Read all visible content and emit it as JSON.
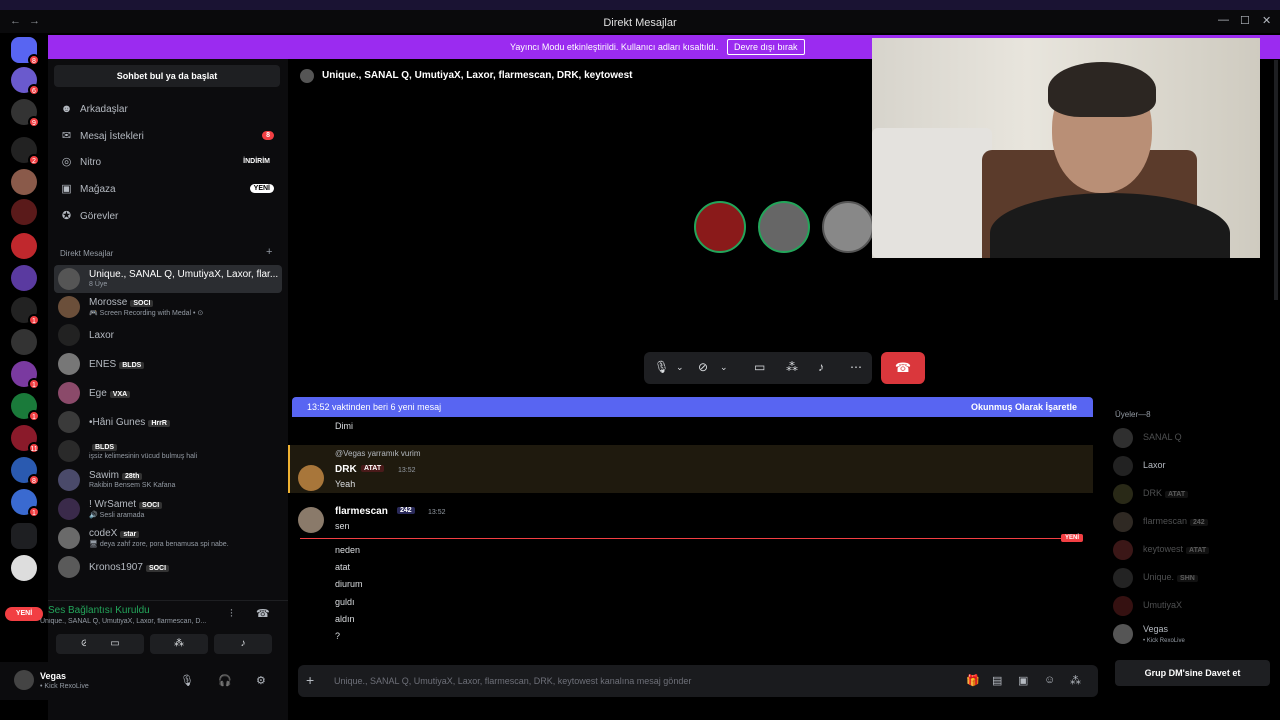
{
  "window": {
    "title": "Direkt Mesajlar",
    "back": "←",
    "forward": "→",
    "minimize": "—",
    "maximize": "☐",
    "close": "✕"
  },
  "banner": {
    "text": "Yayıncı Modu etkinleştirildi. Kullanıcı adları kısaltıldı.",
    "button": "Devre dışı bırak"
  },
  "servers": {
    "badges": [
      "8",
      "6",
      "9",
      "2",
      "1",
      "1",
      "1",
      "11",
      "8",
      "1"
    ],
    "new_pill": "YENİ"
  },
  "sidebar": {
    "search": "Sohbet bul ya da başlat",
    "nav": [
      {
        "label": "Arkadaşlar",
        "icon": "friends-icon",
        "glyph": "☻"
      },
      {
        "label": "Mesaj İstekleri",
        "icon": "mail-icon",
        "glyph": "✉",
        "badge": "8"
      },
      {
        "label": "Nitro",
        "icon": "nitro-icon",
        "glyph": "◎",
        "badge": "İNDİRİM"
      },
      {
        "label": "Mağaza",
        "icon": "shop-icon",
        "glyph": "▣",
        "badge": "YENİ"
      },
      {
        "label": "Görevler",
        "icon": "quests-icon",
        "glyph": "✪"
      }
    ],
    "dm_header": "Direkt Mesajlar",
    "dm_add": "+",
    "dms": [
      {
        "name": "Unique., SANAL Q, UmutiyaX, Laxor, flar...",
        "sub": "8 Üye",
        "color": "#555"
      },
      {
        "name": "Morosse",
        "tag": "SOCI",
        "sub": "🎮 Screen Recording with Medal • ⊙",
        "color": "#6b4f3a"
      },
      {
        "name": "Laxor",
        "color": "#222"
      },
      {
        "name": "ENES",
        "tag": "BLDS",
        "color": "#777"
      },
      {
        "name": "Ege",
        "tag": "VXA",
        "color": "#8b4a6a"
      },
      {
        "name": "•Hâni Gunes",
        "tag": "HrrR",
        "color": "#3a3a3a"
      },
      {
        "name": "",
        "tag": "BLDS",
        "sub": "işsiz kelimesinin vücud bulmuş hali",
        "color": "#2a2a2a"
      },
      {
        "name": "Sawim",
        "tag": "28th",
        "sub": "Rakibin Bensem SK Kafana",
        "color": "#4a4a6a"
      },
      {
        "name": "! WrSamet",
        "tag": "SOCI",
        "sub": "🔊 Sesli aramada",
        "color": "#3a2a4a"
      },
      {
        "name": "codeX",
        "tag": "star",
        "sub": "🖥 deya zahf zore, pora benamusa spi nabe.",
        "color": "#6a6a6a"
      },
      {
        "name": "Kronos1907",
        "tag": "SOCI",
        "color": "#5a5a5a"
      }
    ]
  },
  "voice": {
    "title": "Ses Bağlantısı Kuruldu",
    "subtitle": "Unique., SANAL Q, UmutiyaX, Laxor, flarmescan, D..."
  },
  "user": {
    "name": "Vegas",
    "status": "• Kick RexoLive"
  },
  "channel": {
    "title": "Unique., SANAL Q, UmutiyaX, Laxor, flarmescan, DRK, keytowest"
  },
  "newbar": {
    "left": "13:52 vaktinden beri 6 yeni mesaj",
    "right": "Okunmuş Olarak İşaretle"
  },
  "messages": {
    "top_line": "Dimi",
    "reply_to": "@Vegas yarramık vurim",
    "m1": {
      "author": "DRK",
      "tag": "ATAT",
      "time": "13:52",
      "text": "Yeah"
    },
    "m2": {
      "author": "flarmescan",
      "tag": "242",
      "time": "13:52",
      "text": "sen"
    },
    "new_label": "YENİ",
    "lines": [
      "neden",
      "atat",
      "diurum",
      "guldı",
      "aldın",
      "?"
    ]
  },
  "composer": {
    "plus": "+",
    "placeholder": "Unique., SANAL Q, UmutiyaX, Laxor, flarmescan, DRK, keytowest kanalına mesaj gönder"
  },
  "members": {
    "header": "Üyeler—8",
    "list": [
      {
        "name": "SANAL Q",
        "dim": true,
        "color": "#888"
      },
      {
        "name": "Laxor",
        "dim": false,
        "color": "#222"
      },
      {
        "name": "DRK",
        "tag": "ATAT",
        "dim": true,
        "color": "#774"
      },
      {
        "name": "flarmescan",
        "tag": "242",
        "dim": true,
        "color": "#876"
      },
      {
        "name": "keytowest",
        "tag": "ATAT",
        "dim": true,
        "color": "#a44"
      },
      {
        "name": "Unique.",
        "tag": "SHN",
        "dim": true,
        "color": "#666"
      },
      {
        "name": "UmutiyaX",
        "dim": true,
        "color": "#933"
      },
      {
        "name": "Vegas",
        "sub": "• Kick RexoLive",
        "dim": false,
        "color": "#555"
      }
    ],
    "invite": "Grup DM'sine Davet et"
  },
  "colors": {
    "accent": "#5865f2",
    "banner": "#9b2bf0",
    "online": "#23a55a",
    "danger": "#da373c"
  }
}
